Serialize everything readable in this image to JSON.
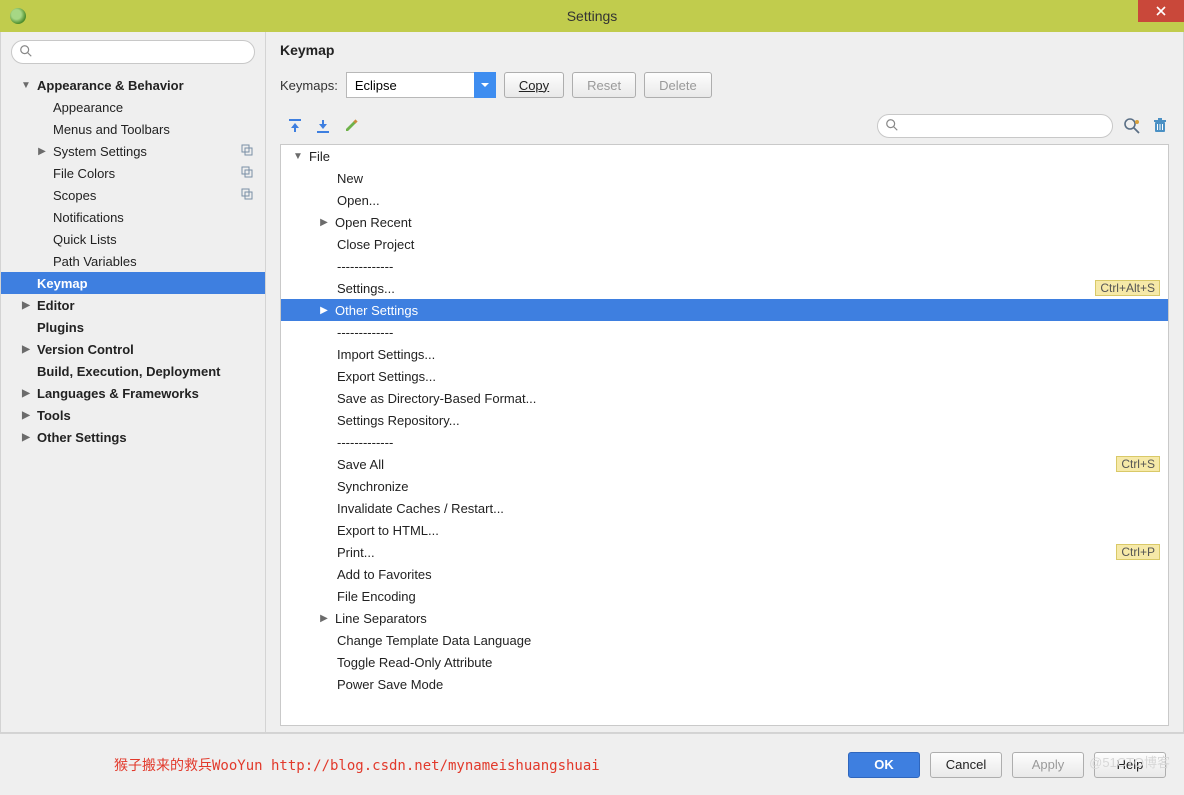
{
  "window": {
    "title": "Settings"
  },
  "sidebar": {
    "search_placeholder": "",
    "items": [
      {
        "label": "Appearance & Behavior",
        "bold": true,
        "level": 1,
        "expander": "down"
      },
      {
        "label": "Appearance",
        "level": 2
      },
      {
        "label": "Menus and Toolbars",
        "level": 2
      },
      {
        "label": "System Settings",
        "level": 2,
        "expander": "right",
        "icon": "stack"
      },
      {
        "label": "File Colors",
        "level": 2,
        "icon": "stack"
      },
      {
        "label": "Scopes",
        "level": 2,
        "icon": "stack"
      },
      {
        "label": "Notifications",
        "level": 2
      },
      {
        "label": "Quick Lists",
        "level": 2
      },
      {
        "label": "Path Variables",
        "level": 2
      },
      {
        "label": "Keymap",
        "level": 1,
        "bold": true,
        "selected": true
      },
      {
        "label": "Editor",
        "level": 1,
        "bold": true,
        "expander": "right"
      },
      {
        "label": "Plugins",
        "level": 1,
        "bold": true
      },
      {
        "label": "Version Control",
        "level": 1,
        "bold": true,
        "expander": "right"
      },
      {
        "label": "Build, Execution, Deployment",
        "level": 1,
        "bold": true
      },
      {
        "label": "Languages & Frameworks",
        "level": 1,
        "bold": true,
        "expander": "right"
      },
      {
        "label": "Tools",
        "level": 1,
        "bold": true,
        "expander": "right"
      },
      {
        "label": "Other Settings",
        "level": 1,
        "bold": true,
        "expander": "right"
      }
    ]
  },
  "main": {
    "heading": "Keymap",
    "keymaps_label": "Keymaps:",
    "keymaps_value": "Eclipse",
    "copy_label": "Copy",
    "reset_label": "Reset",
    "delete_label": "Delete",
    "search_placeholder": "",
    "actions": [
      {
        "label": "File",
        "depth": 0,
        "expander": "down"
      },
      {
        "label": "New",
        "depth": 1
      },
      {
        "label": "Open...",
        "depth": 1
      },
      {
        "label": "Open Recent",
        "depth": 1,
        "expander": "right"
      },
      {
        "label": "Close Project",
        "depth": 1
      },
      {
        "label": "-------------",
        "depth": 1
      },
      {
        "label": "Settings...",
        "depth": 1,
        "shortcut": "Ctrl+Alt+S"
      },
      {
        "label": "Other Settings",
        "depth": 1,
        "expander": "right",
        "selected": true
      },
      {
        "label": "-------------",
        "depth": 1
      },
      {
        "label": "Import Settings...",
        "depth": 1
      },
      {
        "label": "Export Settings...",
        "depth": 1
      },
      {
        "label": "Save as Directory-Based Format...",
        "depth": 1
      },
      {
        "label": "Settings Repository...",
        "depth": 1
      },
      {
        "label": "-------------",
        "depth": 1
      },
      {
        "label": "Save All",
        "depth": 1,
        "shortcut": "Ctrl+S"
      },
      {
        "label": "Synchronize",
        "depth": 1
      },
      {
        "label": "Invalidate Caches / Restart...",
        "depth": 1
      },
      {
        "label": "Export to HTML...",
        "depth": 1
      },
      {
        "label": "Print...",
        "depth": 1,
        "shortcut": "Ctrl+P"
      },
      {
        "label": "Add to Favorites",
        "depth": 1
      },
      {
        "label": "File Encoding",
        "depth": 1
      },
      {
        "label": "Line Separators",
        "depth": 1,
        "expander": "right"
      },
      {
        "label": "Change Template Data Language",
        "depth": 1
      },
      {
        "label": "Toggle Read-Only Attribute",
        "depth": 1
      },
      {
        "label": "Power Save Mode",
        "depth": 1
      }
    ]
  },
  "bottom": {
    "watermark": "猴子搬来的救兵WooYun http://blog.csdn.net/mynameishuangshuai",
    "ok": "OK",
    "cancel": "Cancel",
    "apply": "Apply",
    "help": "Help"
  },
  "side_watermark": "@51CTO博客"
}
